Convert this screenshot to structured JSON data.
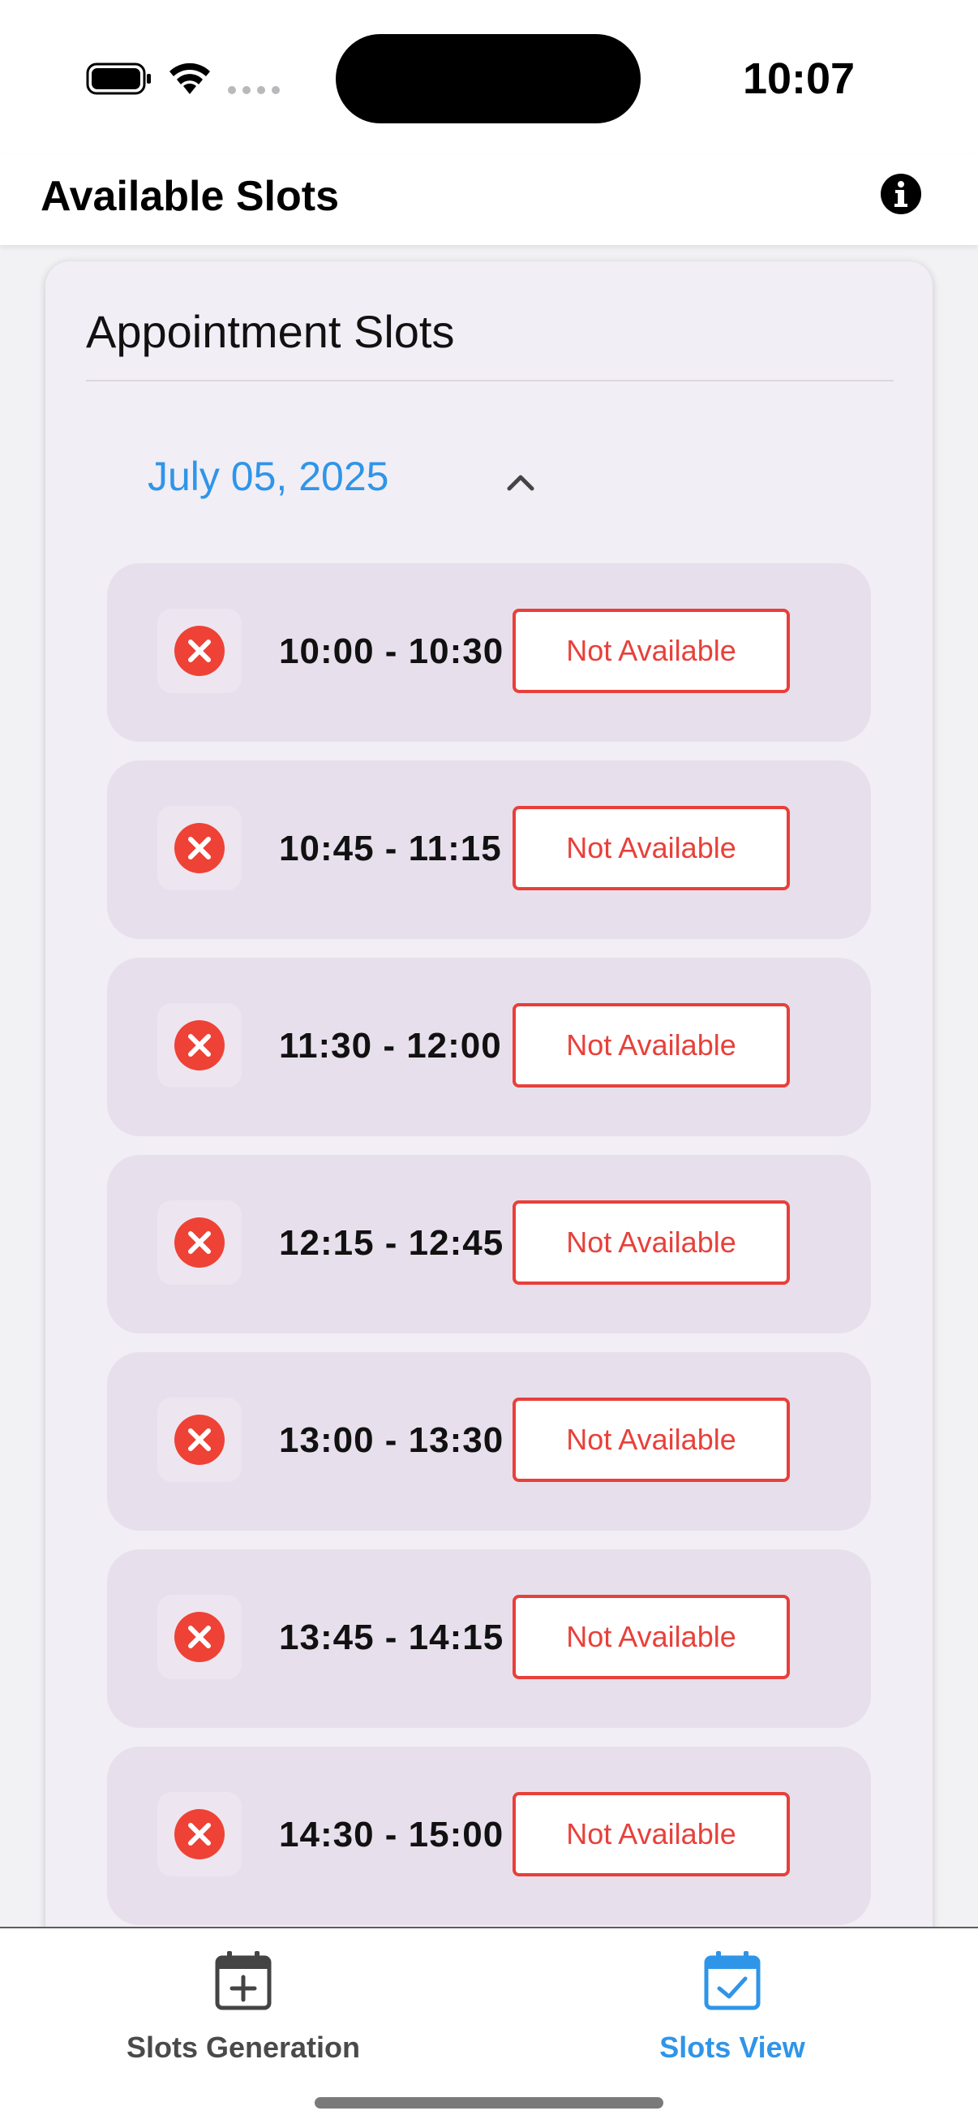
{
  "status_bar": {
    "time": "10:07"
  },
  "app_bar": {
    "title": "Available Slots",
    "info_icon": "info-icon"
  },
  "card": {
    "title": "Appointment Slots",
    "date": "July 05, 2025",
    "slots": [
      {
        "time": "10:00 - 10:30",
        "status": "Not Available"
      },
      {
        "time": "10:45 - 11:15",
        "status": "Not Available"
      },
      {
        "time": "11:30 - 12:00",
        "status": "Not Available"
      },
      {
        "time": "12:15 - 12:45",
        "status": "Not Available"
      },
      {
        "time": "13:00 - 13:30",
        "status": "Not Available"
      },
      {
        "time": "13:45 - 14:15",
        "status": "Not Available"
      },
      {
        "time": "14:30 - 15:00",
        "status": "Not Available"
      }
    ]
  },
  "bottom_nav": {
    "items": [
      {
        "label": "Slots Generation",
        "icon": "calendar-plus-icon",
        "active": false
      },
      {
        "label": "Slots View",
        "icon": "calendar-check-icon",
        "active": true
      }
    ]
  },
  "colors": {
    "accent": "#2f95e8",
    "unavailable": "#e8403a",
    "card_bg": "#f2eef5",
    "slot_bg": "#e7e0ec"
  }
}
